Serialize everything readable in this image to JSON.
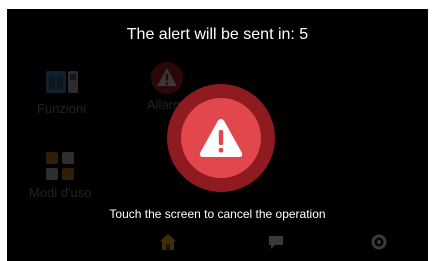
{
  "countdown_title": "The alert will be sent in: 5",
  "cancel_hint": "Touch the screen to cancel the operation",
  "background_apps": {
    "funzioni": "Funzioni",
    "allarmi": "Allarmi",
    "modi": "Modi d'uso"
  },
  "colors": {
    "alert_outer": "#8f1a20",
    "alert_inner": "#e2474d",
    "background": "#000000",
    "text": "#ffffff"
  },
  "icons": {
    "alert": "warning-triangle-icon",
    "nav_home": "home-icon",
    "nav_messages": "chat-icon",
    "nav_settings": "settings-icon"
  }
}
